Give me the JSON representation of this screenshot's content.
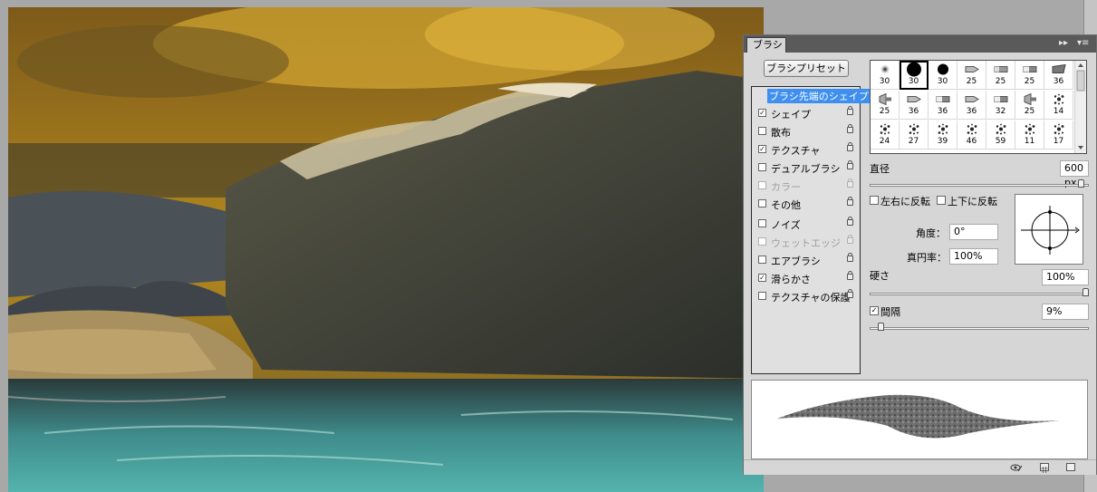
{
  "panel": {
    "tab_label": "ブラシ",
    "collapse_glyph": "▸▸",
    "menu_glyph": "▾≡",
    "preset_button": "ブラシプリセット"
  },
  "options": [
    {
      "label": "ブラシ先端のシェイプ",
      "checkbox": false,
      "checked": false,
      "enabled": true,
      "lock": false,
      "selected": true
    },
    {
      "label": "シェイプ",
      "checkbox": true,
      "checked": true,
      "enabled": true,
      "lock": true
    },
    {
      "label": "散布",
      "checkbox": true,
      "checked": false,
      "enabled": true,
      "lock": true
    },
    {
      "label": "テクスチャ",
      "checkbox": true,
      "checked": true,
      "enabled": true,
      "lock": true
    },
    {
      "label": "デュアルブラシ",
      "checkbox": true,
      "checked": false,
      "enabled": true,
      "lock": true
    },
    {
      "label": "カラー",
      "checkbox": true,
      "checked": false,
      "enabled": false,
      "lock": true
    },
    {
      "label": "その他",
      "checkbox": true,
      "checked": false,
      "enabled": true,
      "lock": true
    },
    {
      "label": "ノイズ",
      "checkbox": true,
      "checked": false,
      "enabled": true,
      "lock": true
    },
    {
      "label": "ウェットエッジ",
      "checkbox": true,
      "checked": false,
      "enabled": false,
      "lock": true
    },
    {
      "label": "エアブラシ",
      "checkbox": true,
      "checked": false,
      "enabled": true,
      "lock": true
    },
    {
      "label": "滑らかさ",
      "checkbox": true,
      "checked": true,
      "enabled": true,
      "lock": true
    },
    {
      "label": "テクスチャの保護",
      "checkbox": true,
      "checked": false,
      "enabled": true,
      "lock": true
    }
  ],
  "brush_tips": [
    {
      "size": "30",
      "kind": "soft-dot"
    },
    {
      "size": "30",
      "kind": "hard-dot-large",
      "selected": true
    },
    {
      "size": "30",
      "kind": "hard-dot"
    },
    {
      "size": "25",
      "kind": "marker"
    },
    {
      "size": "25",
      "kind": "chisel"
    },
    {
      "size": "25",
      "kind": "flat"
    },
    {
      "size": "36",
      "kind": "angle"
    },
    {
      "size": "25",
      "kind": "fan"
    },
    {
      "size": "36",
      "kind": "marker"
    },
    {
      "size": "36",
      "kind": "flat"
    },
    {
      "size": "36",
      "kind": "marker"
    },
    {
      "size": "32",
      "kind": "flat"
    },
    {
      "size": "25",
      "kind": "fan"
    },
    {
      "size": "14",
      "kind": "splatter"
    },
    {
      "size": "24",
      "kind": "splatter"
    },
    {
      "size": "27",
      "kind": "splatter"
    },
    {
      "size": "39",
      "kind": "splatter"
    },
    {
      "size": "46",
      "kind": "splatter"
    },
    {
      "size": "59",
      "kind": "splatter"
    },
    {
      "size": "11",
      "kind": "splatter"
    },
    {
      "size": "17",
      "kind": "splatter"
    }
  ],
  "settings": {
    "diameter_label": "直径",
    "diameter_value": "600 px",
    "diameter_slider": 0.98,
    "flip_x_label": "左右に反転",
    "flip_y_label": "上下に反転",
    "angle_label": "角度：",
    "angle_value": "0°",
    "roundness_label": "真円率：",
    "roundness_value": "100%",
    "hardness_label": "硬さ",
    "hardness_value": "100%",
    "hardness_slider": 1.0,
    "spacing_label": "間隔",
    "spacing_value": "9%",
    "spacing_checked": true,
    "spacing_slider": 0.04
  },
  "footer_icons": [
    "eye-brush-icon",
    "grid-icon",
    "new-preset-icon"
  ],
  "colors": {
    "selection": "#3e8ff0",
    "panel_bg": "#d6d6d6",
    "header_bg": "#5a5a5a"
  }
}
